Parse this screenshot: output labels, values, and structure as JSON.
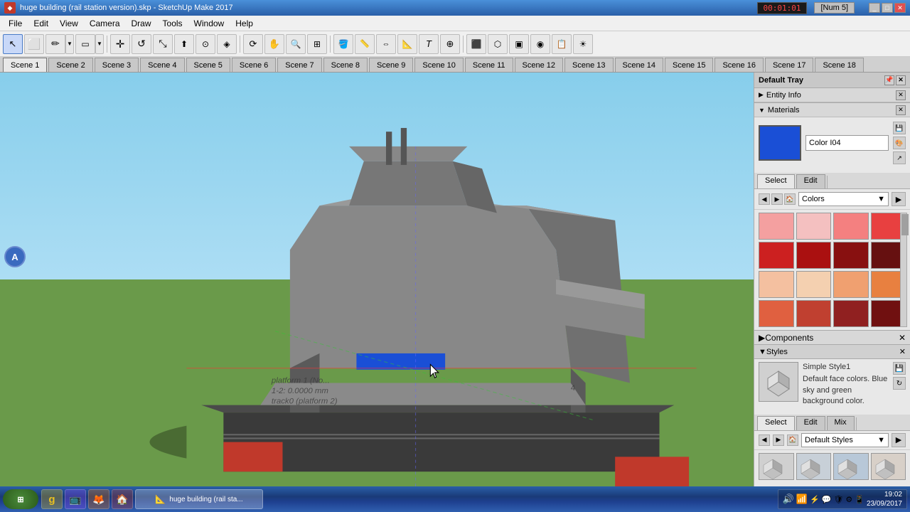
{
  "titlebar": {
    "icon": "◆",
    "title": "huge building (rail station version).skp - SketchUp Make 2017",
    "timer": "00:01:01",
    "numpad": "[Num 5]",
    "min_label": "_",
    "max_label": "□",
    "close_label": "✕"
  },
  "menubar": {
    "items": [
      "File",
      "Edit",
      "View",
      "Camera",
      "Draw",
      "Tools",
      "Window",
      "Help"
    ]
  },
  "toolbar": {
    "tools": [
      {
        "name": "select-tool",
        "icon": "↖",
        "active": true
      },
      {
        "name": "paint-tool",
        "icon": "✏"
      },
      {
        "name": "pencil-tool",
        "icon": "✏"
      },
      {
        "name": "pencil-dropdown",
        "icon": "▼"
      },
      {
        "name": "shape-tool",
        "icon": "◻"
      },
      {
        "name": "shape-dropdown",
        "icon": "▼"
      },
      {
        "name": "move-tool",
        "icon": "✛"
      },
      {
        "name": "follow-tool",
        "icon": "⊙"
      },
      {
        "name": "offset-tool",
        "icon": "◈"
      },
      {
        "name": "rotate-tool",
        "icon": "↺"
      },
      {
        "name": "scale-tool",
        "icon": "⊡"
      },
      {
        "name": "push-tool",
        "icon": "⬆"
      },
      {
        "name": "orbit-tool",
        "icon": "⟳"
      },
      {
        "name": "zoom-tool",
        "icon": "🔍"
      },
      {
        "name": "zoom-extents",
        "icon": "⊞"
      },
      {
        "name": "pan-tool",
        "icon": "✋"
      },
      {
        "name": "paint-bucket",
        "icon": "🪣"
      },
      {
        "name": "measure-tool",
        "icon": "📏"
      },
      {
        "name": "text-tool",
        "icon": "T"
      },
      {
        "name": "axes-tool",
        "icon": "⊕"
      },
      {
        "name": "3d-text",
        "icon": "A"
      },
      {
        "name": "section-tool",
        "icon": "⊟"
      },
      {
        "name": "components",
        "icon": "⬡"
      },
      {
        "name": "materials",
        "icon": "▣"
      },
      {
        "name": "styles",
        "icon": "◉"
      }
    ]
  },
  "scenes": {
    "tabs": [
      "Scene 1",
      "Scene 2",
      "Scene 3",
      "Scene 4",
      "Scene 5",
      "Scene 6",
      "Scene 7",
      "Scene 8",
      "Scene 9",
      "Scene 10",
      "Scene 11",
      "Scene 12",
      "Scene 13",
      "Scene 14",
      "Scene 15",
      "Scene 16",
      "Scene 17",
      "Scene 18"
    ],
    "active": "Scene 1"
  },
  "viewport": {
    "tooltip_line1": "platform 1 (No...",
    "tooltip_line2": "1-2: 0.0000 mm (platform 2)",
    "tooltip_extra": "4"
  },
  "right_panel": {
    "header": "Default Tray",
    "entity_info_label": "Entity Info",
    "materials_label": "Materials",
    "material_name": "Color I04",
    "select_tab": "Select",
    "edit_tab": "Edit",
    "colors_label": "Colors",
    "color_grid": [
      "#f4a0a0",
      "#f4c0c0",
      "#f48080",
      "#e84040",
      "#cc2020",
      "#aa1010",
      "#881010",
      "#661010",
      "#f4c0a0",
      "#f4d0b0",
      "#f0a070",
      "#e88040",
      "#e06040",
      "#c04030",
      "#902020",
      "#701010"
    ],
    "components_label": "Components",
    "styles_label": "Styles",
    "style_name": "Simple Style1",
    "style_desc": "Default face colors. Blue sky and green background color.",
    "style_select_tab": "Select",
    "style_edit_tab": "Edit",
    "style_mix_tab": "Mix",
    "style_dropdown": "Default Styles",
    "style_thumbs_colors": [
      "#c8c8c8",
      "#d0d0d0",
      "#b8b8b8",
      "#e0e0e0"
    ]
  },
  "taskbar": {
    "start_icon": "⊞",
    "apps": [
      {
        "name": "glyph-app",
        "icon": "g",
        "color": "#e8c020"
      },
      {
        "name": "twitch-app",
        "icon": "📺",
        "color": "#9146ff"
      },
      {
        "name": "fox-app",
        "icon": "🦊",
        "color": "#e87020"
      },
      {
        "name": "sketchup-app",
        "icon": "🏠",
        "color": "#c0392b"
      },
      {
        "name": "active-sketchup",
        "icon": "📐",
        "color": "#c0392b",
        "active": true
      }
    ],
    "tray_icons": [
      "🔊",
      "📶",
      "🔋",
      "💬",
      "🛡",
      "⚙",
      "📱"
    ],
    "time": "19:02",
    "date": "23/09/2017"
  }
}
